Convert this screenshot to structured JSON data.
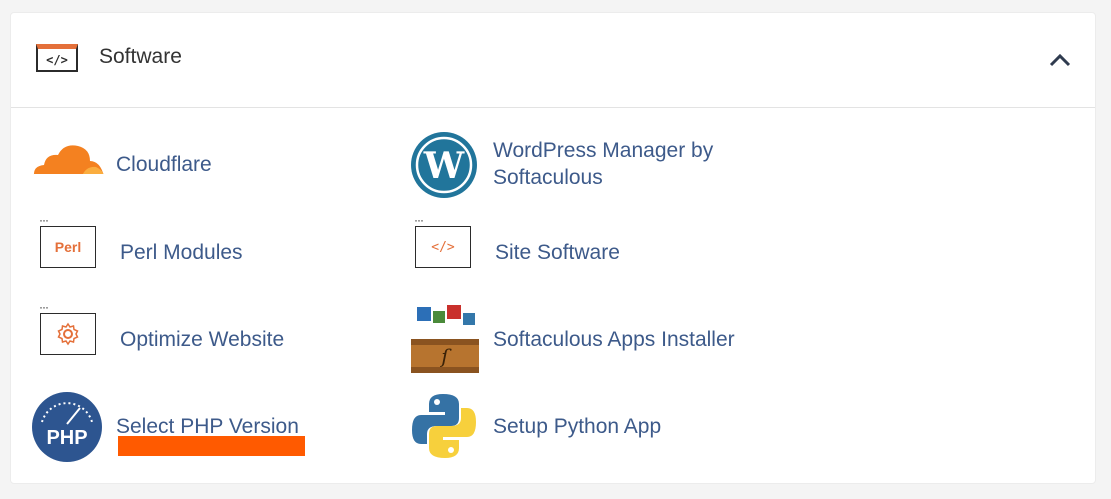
{
  "section": {
    "title": "Software",
    "header_icon_text": "</>",
    "collapse_icon": "chevron-up-icon"
  },
  "items": {
    "cloudflare": {
      "label": "Cloudflare",
      "icon": "cloudflare-cloud-icon"
    },
    "wordpress": {
      "label_line1": "WordPress Manager by",
      "label_line2": "Softaculous",
      "icon": "wordpress-icon"
    },
    "perl": {
      "label": "Perl Modules",
      "icon_text": "Perl",
      "icon": "perl-icon"
    },
    "site_software": {
      "label": "Site Software",
      "icon_text": "</>",
      "icon": "code-icon"
    },
    "optimize": {
      "label": "Optimize Website",
      "icon": "gear-icon"
    },
    "softaculous": {
      "label": "Softaculous Apps Installer",
      "icon": "softaculous-box-icon"
    },
    "php": {
      "label": "Select PHP Version",
      "icon_text": "PHP",
      "icon": "php-gauge-icon"
    },
    "python": {
      "label": "Setup Python App",
      "icon": "python-icon"
    }
  },
  "colors": {
    "accent_orange": "#e4703a",
    "link_blue": "#3d5a8a",
    "highlight": "#ff5a00"
  }
}
